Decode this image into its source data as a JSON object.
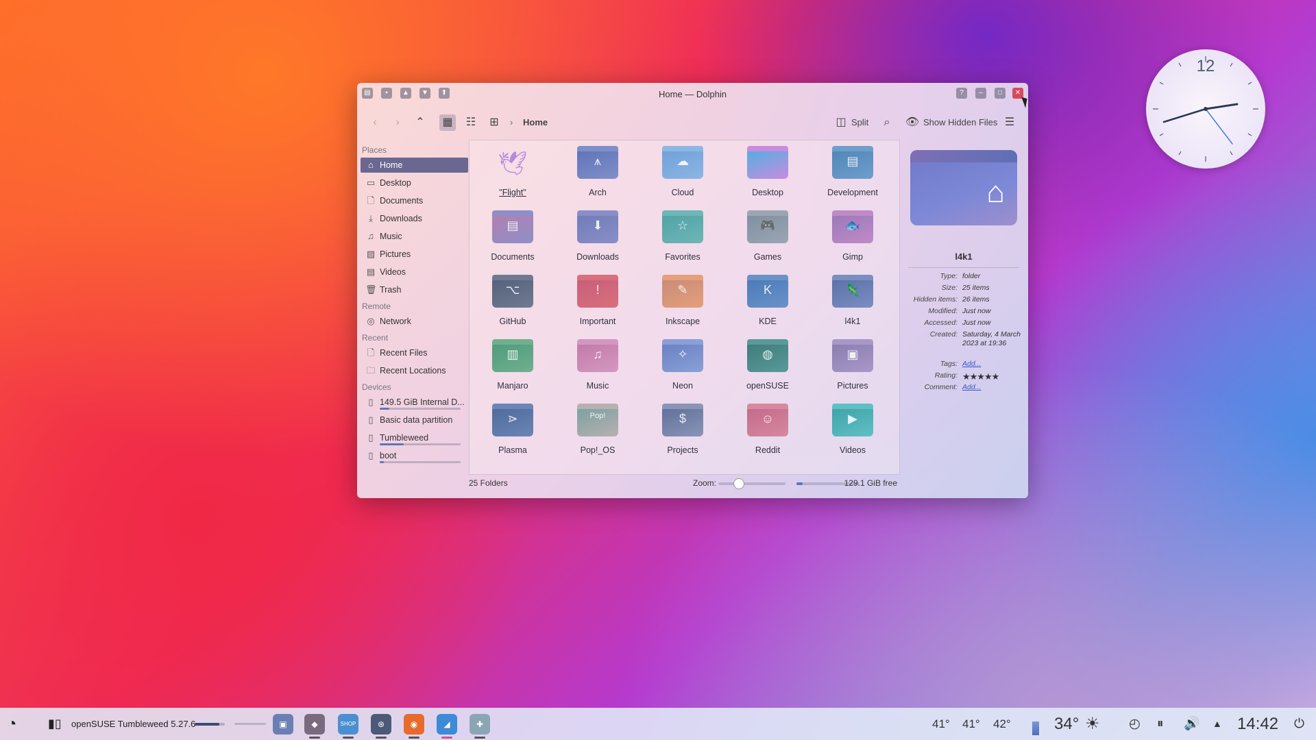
{
  "window": {
    "title": "Home — Dolphin",
    "titlebar_left_icons": [
      "app-menu-icon",
      "pin-icon",
      "keep-above-icon",
      "keep-below-icon",
      "shade-icon"
    ],
    "titlebar_right_icons": [
      "help-icon",
      "minimize-icon",
      "maximize-icon",
      "close-icon"
    ]
  },
  "toolbar": {
    "breadcrumb_sep": "›",
    "location": "Home",
    "split_label": "Split",
    "show_hidden_label": "Show Hidden Files"
  },
  "sidebar": {
    "places_heading": "Places",
    "places": [
      {
        "label": "Home",
        "icon": "home-icon"
      },
      {
        "label": "Desktop",
        "icon": "desktop-icon"
      },
      {
        "label": "Documents",
        "icon": "documents-icon"
      },
      {
        "label": "Downloads",
        "icon": "downloads-icon"
      },
      {
        "label": "Music",
        "icon": "music-icon"
      },
      {
        "label": "Pictures",
        "icon": "pictures-icon"
      },
      {
        "label": "Videos",
        "icon": "videos-icon"
      },
      {
        "label": "Trash",
        "icon": "trash-icon"
      }
    ],
    "remote_heading": "Remote",
    "remote": [
      {
        "label": "Network",
        "icon": "network-icon"
      }
    ],
    "recent_heading": "Recent",
    "recent": [
      {
        "label": "Recent Files",
        "icon": "recent-files-icon"
      },
      {
        "label": "Recent Locations",
        "icon": "recent-locations-icon"
      }
    ],
    "devices_heading": "Devices",
    "devices": [
      {
        "label": "149.5 GiB Internal D...",
        "usage": 0.12
      },
      {
        "label": "Basic data partition",
        "usage": null
      },
      {
        "label": "Tumbleweed",
        "usage": 0.3
      },
      {
        "label": "boot",
        "usage": 0.05
      }
    ]
  },
  "folders": [
    {
      "label": "\"Flight\"",
      "icon": "flight-icon"
    },
    {
      "label": "Arch",
      "icon": "arch-icon"
    },
    {
      "label": "Cloud",
      "icon": "cloud-icon"
    },
    {
      "label": "Desktop",
      "icon": "desktop-folder-icon"
    },
    {
      "label": "Development",
      "icon": "development-icon"
    },
    {
      "label": "Documents",
      "icon": "documents-folder-icon"
    },
    {
      "label": "Downloads",
      "icon": "downloads-folder-icon"
    },
    {
      "label": "Favorites",
      "icon": "favorites-icon"
    },
    {
      "label": "Games",
      "icon": "games-icon"
    },
    {
      "label": "Gimp",
      "icon": "gimp-icon"
    },
    {
      "label": "GitHub",
      "icon": "github-icon"
    },
    {
      "label": "Important",
      "icon": "important-icon"
    },
    {
      "label": "Inkscape",
      "icon": "inkscape-icon"
    },
    {
      "label": "KDE",
      "icon": "kde-icon"
    },
    {
      "label": "l4k1",
      "icon": "l4k1-icon"
    },
    {
      "label": "Manjaro",
      "icon": "manjaro-icon"
    },
    {
      "label": "Music",
      "icon": "music-folder-icon"
    },
    {
      "label": "Neon",
      "icon": "neon-icon"
    },
    {
      "label": "openSUSE",
      "icon": "opensuse-icon"
    },
    {
      "label": "Pictures",
      "icon": "pictures-folder-icon"
    },
    {
      "label": "Plasma",
      "icon": "plasma-icon"
    },
    {
      "label": "Pop!_OS",
      "icon": "popos-icon"
    },
    {
      "label": "Projects",
      "icon": "projects-icon"
    },
    {
      "label": "Reddit",
      "icon": "reddit-icon"
    },
    {
      "label": "Videos",
      "icon": "videos-folder-icon"
    }
  ],
  "status": {
    "count": "25 Folders",
    "zoom_label": "Zoom:",
    "zoom_level": 0.3,
    "space_used": 0.1,
    "free": "129.1 GiB free"
  },
  "info_panel": {
    "name": "l4k1",
    "rows": [
      {
        "k": "Type:",
        "v": "folder"
      },
      {
        "k": "Size:",
        "v": "25 items"
      },
      {
        "k": "Hidden items:",
        "v": "26 items"
      },
      {
        "k": "Modified:",
        "v": "Just now"
      },
      {
        "k": "Accessed:",
        "v": "Just now"
      },
      {
        "k": "Created:",
        "v": "Saturday, 4 March 2023 at 19:36"
      },
      {
        "k": "Tags:",
        "v": "Add..."
      },
      {
        "k": "Rating:",
        "v": ""
      },
      {
        "k": "Comment:",
        "v": "Add..."
      }
    ],
    "rating_stars": 5
  },
  "clock_number": "12",
  "taskbar": {
    "window_title": "openSUSE Tumbleweed 5.27.6",
    "apps": [
      "app-launcher-icon",
      "pager-icon",
      "image-viewer-icon",
      "store-icon",
      "system-settings-icon",
      "firefox-icon",
      "dolphin-icon",
      "app-icon"
    ],
    "temps": [
      "41°",
      "41°",
      "42°"
    ],
    "weather_temp": "34°",
    "time": "14:42"
  },
  "colors": {
    "accent": "#6a6890",
    "link": "#3a56c8",
    "selected_text": "#ffffff"
  }
}
